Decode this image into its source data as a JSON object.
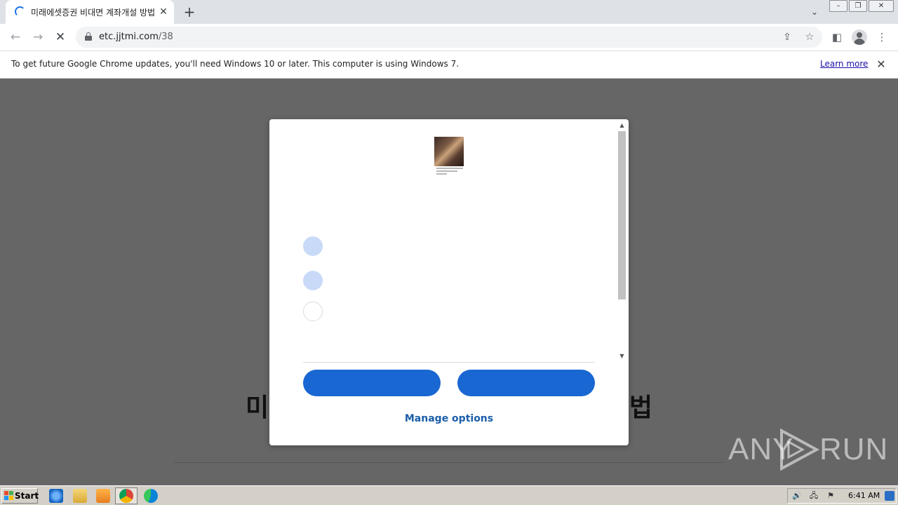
{
  "browser": {
    "tab_title": "미래에셋증권 비대면 계좌개설 방법",
    "tab_close": "✕",
    "new_tab": "+",
    "tab_search": "⌄",
    "window_minimize": "–",
    "window_restore": "❐",
    "window_close": "✕",
    "url_host": "etc.jjtmi.com",
    "url_path": "/38",
    "back": "←",
    "forward": "→",
    "stop": "✕",
    "share_icon": "⇪",
    "star_icon": "☆",
    "sidepanel_icon": "◧",
    "menu_icon": "⋮"
  },
  "infobar": {
    "message": "To get future Google Chrome updates, you'll need Windows 10 or later. This computer is using Windows 7.",
    "link": "Learn more",
    "close": "✕"
  },
  "page": {
    "heading_left": "미",
    "heading_right": "법"
  },
  "dialog": {
    "manage_options": "Manage options",
    "options": [
      {
        "state": "on"
      },
      {
        "state": "on"
      },
      {
        "state": "off"
      }
    ],
    "scroll_up": "▲",
    "scroll_down": "▼"
  },
  "watermark": {
    "text_left": "ANY",
    "text_right": "RUN"
  },
  "taskbar": {
    "start_label": "Start",
    "clock": "6:41 AM",
    "tray_icons": [
      "🔊",
      "🖧",
      "⚑"
    ]
  },
  "colors": {
    "accent_blue": "#1967d2",
    "option_on": "#c9daf8",
    "link_blue": "#1a5da8"
  }
}
